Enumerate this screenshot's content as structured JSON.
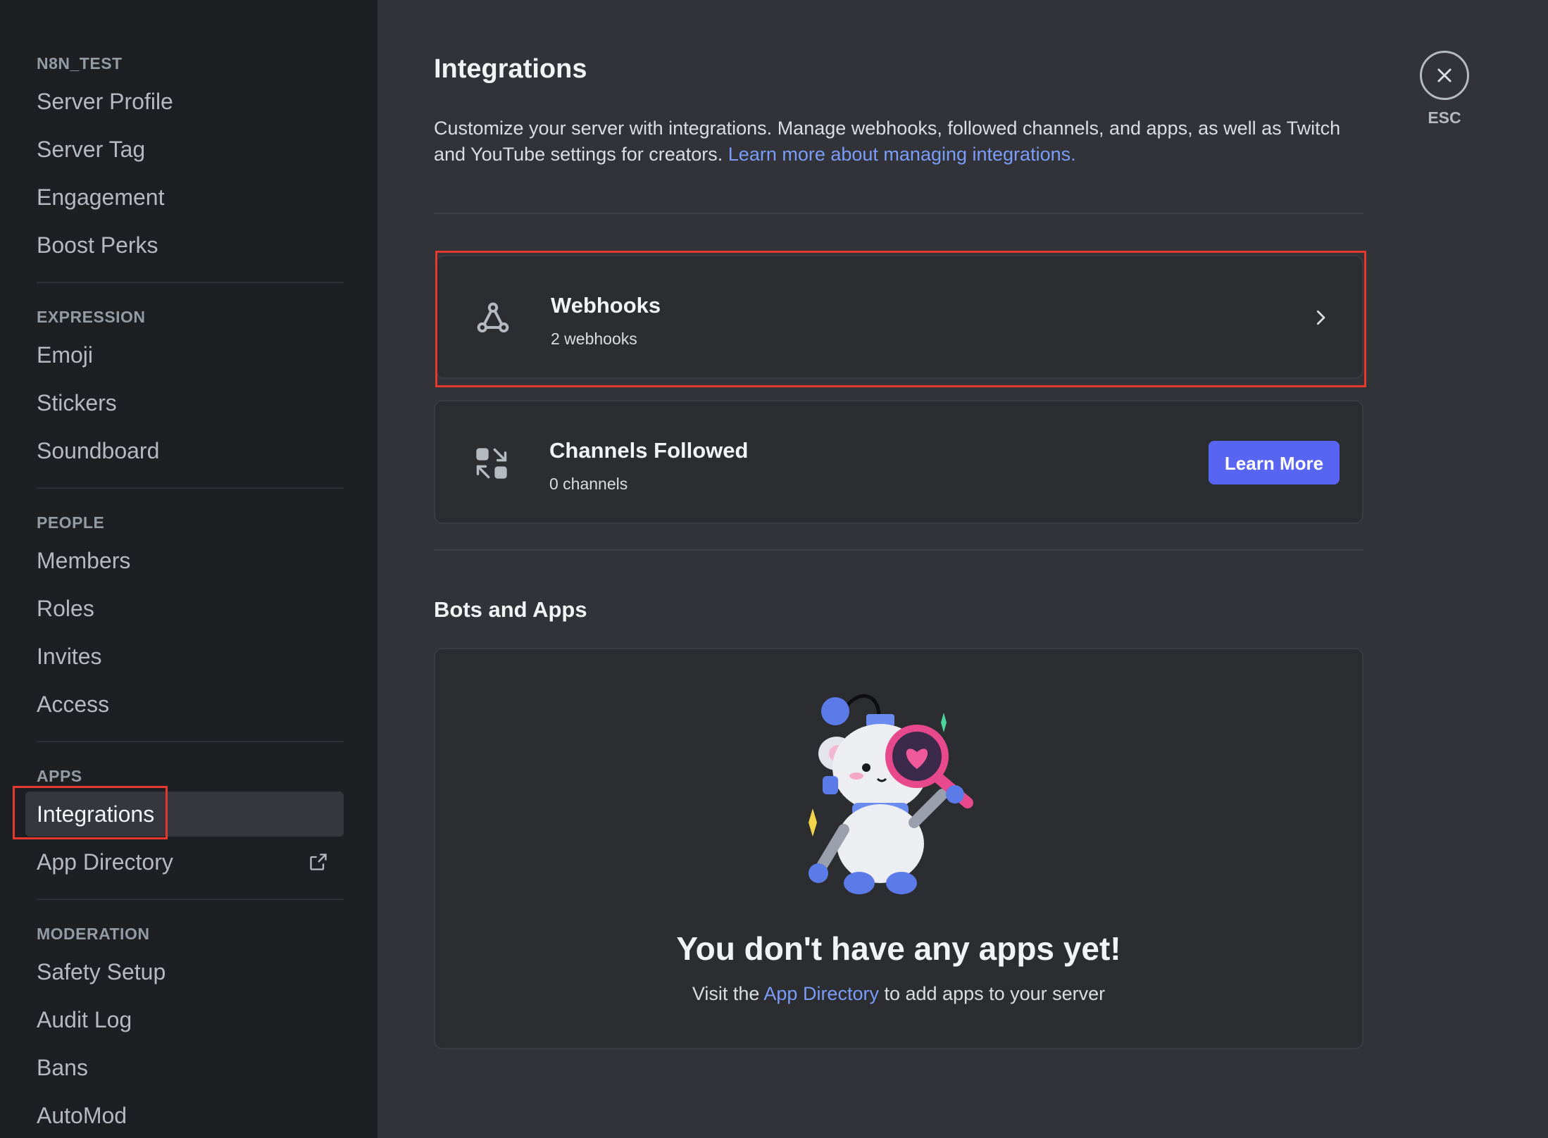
{
  "sidebar": {
    "sections": [
      {
        "header": "N8N_TEST",
        "items": [
          {
            "label": "Server Profile"
          },
          {
            "label": "Server Tag"
          },
          {
            "label": "Engagement"
          },
          {
            "label": "Boost Perks"
          }
        ]
      },
      {
        "header": "EXPRESSION",
        "items": [
          {
            "label": "Emoji"
          },
          {
            "label": "Stickers"
          },
          {
            "label": "Soundboard"
          }
        ]
      },
      {
        "header": "PEOPLE",
        "items": [
          {
            "label": "Members"
          },
          {
            "label": "Roles"
          },
          {
            "label": "Invites"
          },
          {
            "label": "Access"
          }
        ]
      },
      {
        "header": "APPS",
        "items": [
          {
            "label": "Integrations",
            "active": true
          },
          {
            "label": "App Directory",
            "icon": "external-link-icon"
          }
        ]
      },
      {
        "header": "MODERATION",
        "items": [
          {
            "label": "Safety Setup"
          },
          {
            "label": "Audit Log"
          },
          {
            "label": "Bans"
          },
          {
            "label": "AutoMod"
          }
        ]
      }
    ]
  },
  "main": {
    "title": "Integrations",
    "description": "Customize your server with integrations. Manage webhooks, followed channels, and apps, as well as Twitch and YouTube settings for creators.",
    "description_link": "Learn more about managing integrations.",
    "cards": {
      "webhooks": {
        "title": "Webhooks",
        "subtitle": "2 webhooks",
        "icon": "webhook-icon"
      },
      "channels": {
        "title": "Channels Followed",
        "subtitle": "0 channels",
        "icon": "channels-followed-icon",
        "button": "Learn More"
      }
    },
    "bots_section": {
      "title": "Bots and Apps",
      "empty_title": "You don't have any apps yet!",
      "empty_prefix": "Visit the",
      "empty_link": "App Directory",
      "empty_suffix": "to add apps to your server"
    }
  },
  "close": {
    "label": "ESC",
    "icon": "close-icon"
  },
  "colors": {
    "accent": "#5865f2",
    "link": "#7b9cf7",
    "highlight": "#e5382f"
  }
}
